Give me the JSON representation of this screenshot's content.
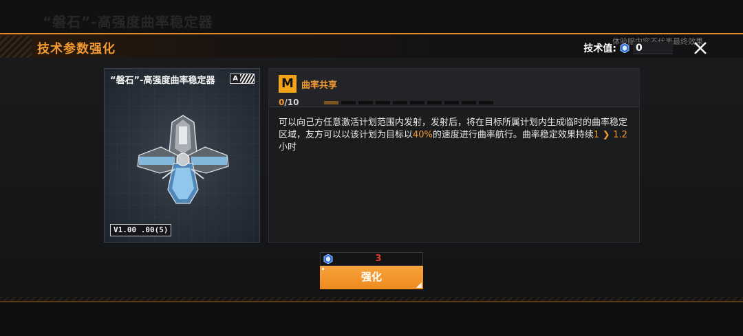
{
  "background": {
    "top_title": "“磐石”-高强度曲率稳定器",
    "bottom_hint": "",
    "notice": "体验服内容不代表最终效果"
  },
  "header": {
    "title": "技术参数强化",
    "tech_value_label": "技术值:",
    "tech_value": "0",
    "close_icon": "close-icon"
  },
  "ship": {
    "name": "“磐石”-高强度曲率稳定器",
    "grade": "A",
    "version": "V1.00 .00(5)"
  },
  "skill": {
    "badge": "M",
    "name": "曲率共享",
    "level_current": "0",
    "level_max": "/10",
    "level_filled": 1,
    "level_total": 10,
    "desc_part1": "可以向己方任意激活计划范围内发射，发射后，将在目标所属计划内生成临时的曲率稳定区域，友方可以以该计划为目标以",
    "desc_highlight": "40%",
    "desc_part2": "的速度进行曲率航行。曲率稳定效果持续",
    "duration_from": "1",
    "duration_to": "1.2",
    "duration_unit": "小时"
  },
  "cost": {
    "amount": "3"
  },
  "enhance_button": "强化",
  "colors": {
    "accent": "#f29a32",
    "cost_red": "#e23b2f",
    "badge": "#f2a318"
  }
}
